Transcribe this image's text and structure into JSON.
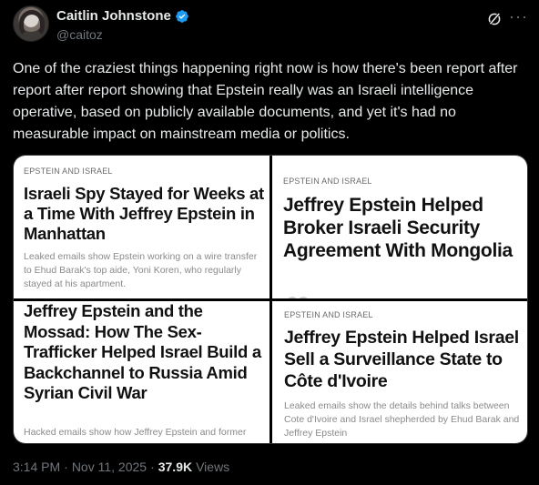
{
  "author": {
    "name": "Caitlin Johnstone",
    "handle": "@caitoz"
  },
  "tweet": {
    "text": "One of the craziest things happening right now is how there's been report after report after report showing that Epstein really was an Israeli intelligence operative, based on publicly available documents, and yet it's had no measurable impact on mainstream media or politics."
  },
  "media": [
    {
      "kicker": "EPSTEIN AND ISRAEL",
      "headline": "Israeli Spy Stayed for Weeks at a Time With Jeffrey Epstein in Manhattan",
      "dek": "Leaked emails show Epstein working on a wire transfer to Ehud Barak's top aide, Yoni Koren, who regularly stayed at his apartment."
    },
    {
      "kicker": "EPSTEIN AND ISRAEL",
      "headline": "Jeffrey Epstein Helped Broker Israeli Security Agreement With Mongolia",
      "dek": ""
    },
    {
      "kicker": "",
      "headline": "Jeffrey Epstein and the Mossad: How The Sex-Trafficker Helped Israel Build a Backchannel to Russia Amid Syrian Civil War",
      "dek": "Hacked emails show how Jeffrey Epstein and former"
    },
    {
      "kicker": "EPSTEIN AND ISRAEL",
      "headline": "Jeffrey Epstein Helped Israel Sell a Surveillance State to Côte d'Ivoire",
      "dek": "Leaked emails show the details behind talks between Cote d'Ivoire and Israel shepherded by Ehud Barak and Jeffrey Epstein"
    }
  ],
  "footer": {
    "time": "3:14 PM",
    "separator": "·",
    "date": "Nov 11, 2025",
    "views_count": "37.9K",
    "views_label": "Views"
  },
  "icons": {
    "verified": "verified-badge-icon",
    "grok": "grok-icon",
    "more": "more-icon"
  },
  "colors": {
    "background": "#000000",
    "text": "#e7e9ea",
    "muted": "#71767b",
    "verified": "#1d9bf0"
  }
}
